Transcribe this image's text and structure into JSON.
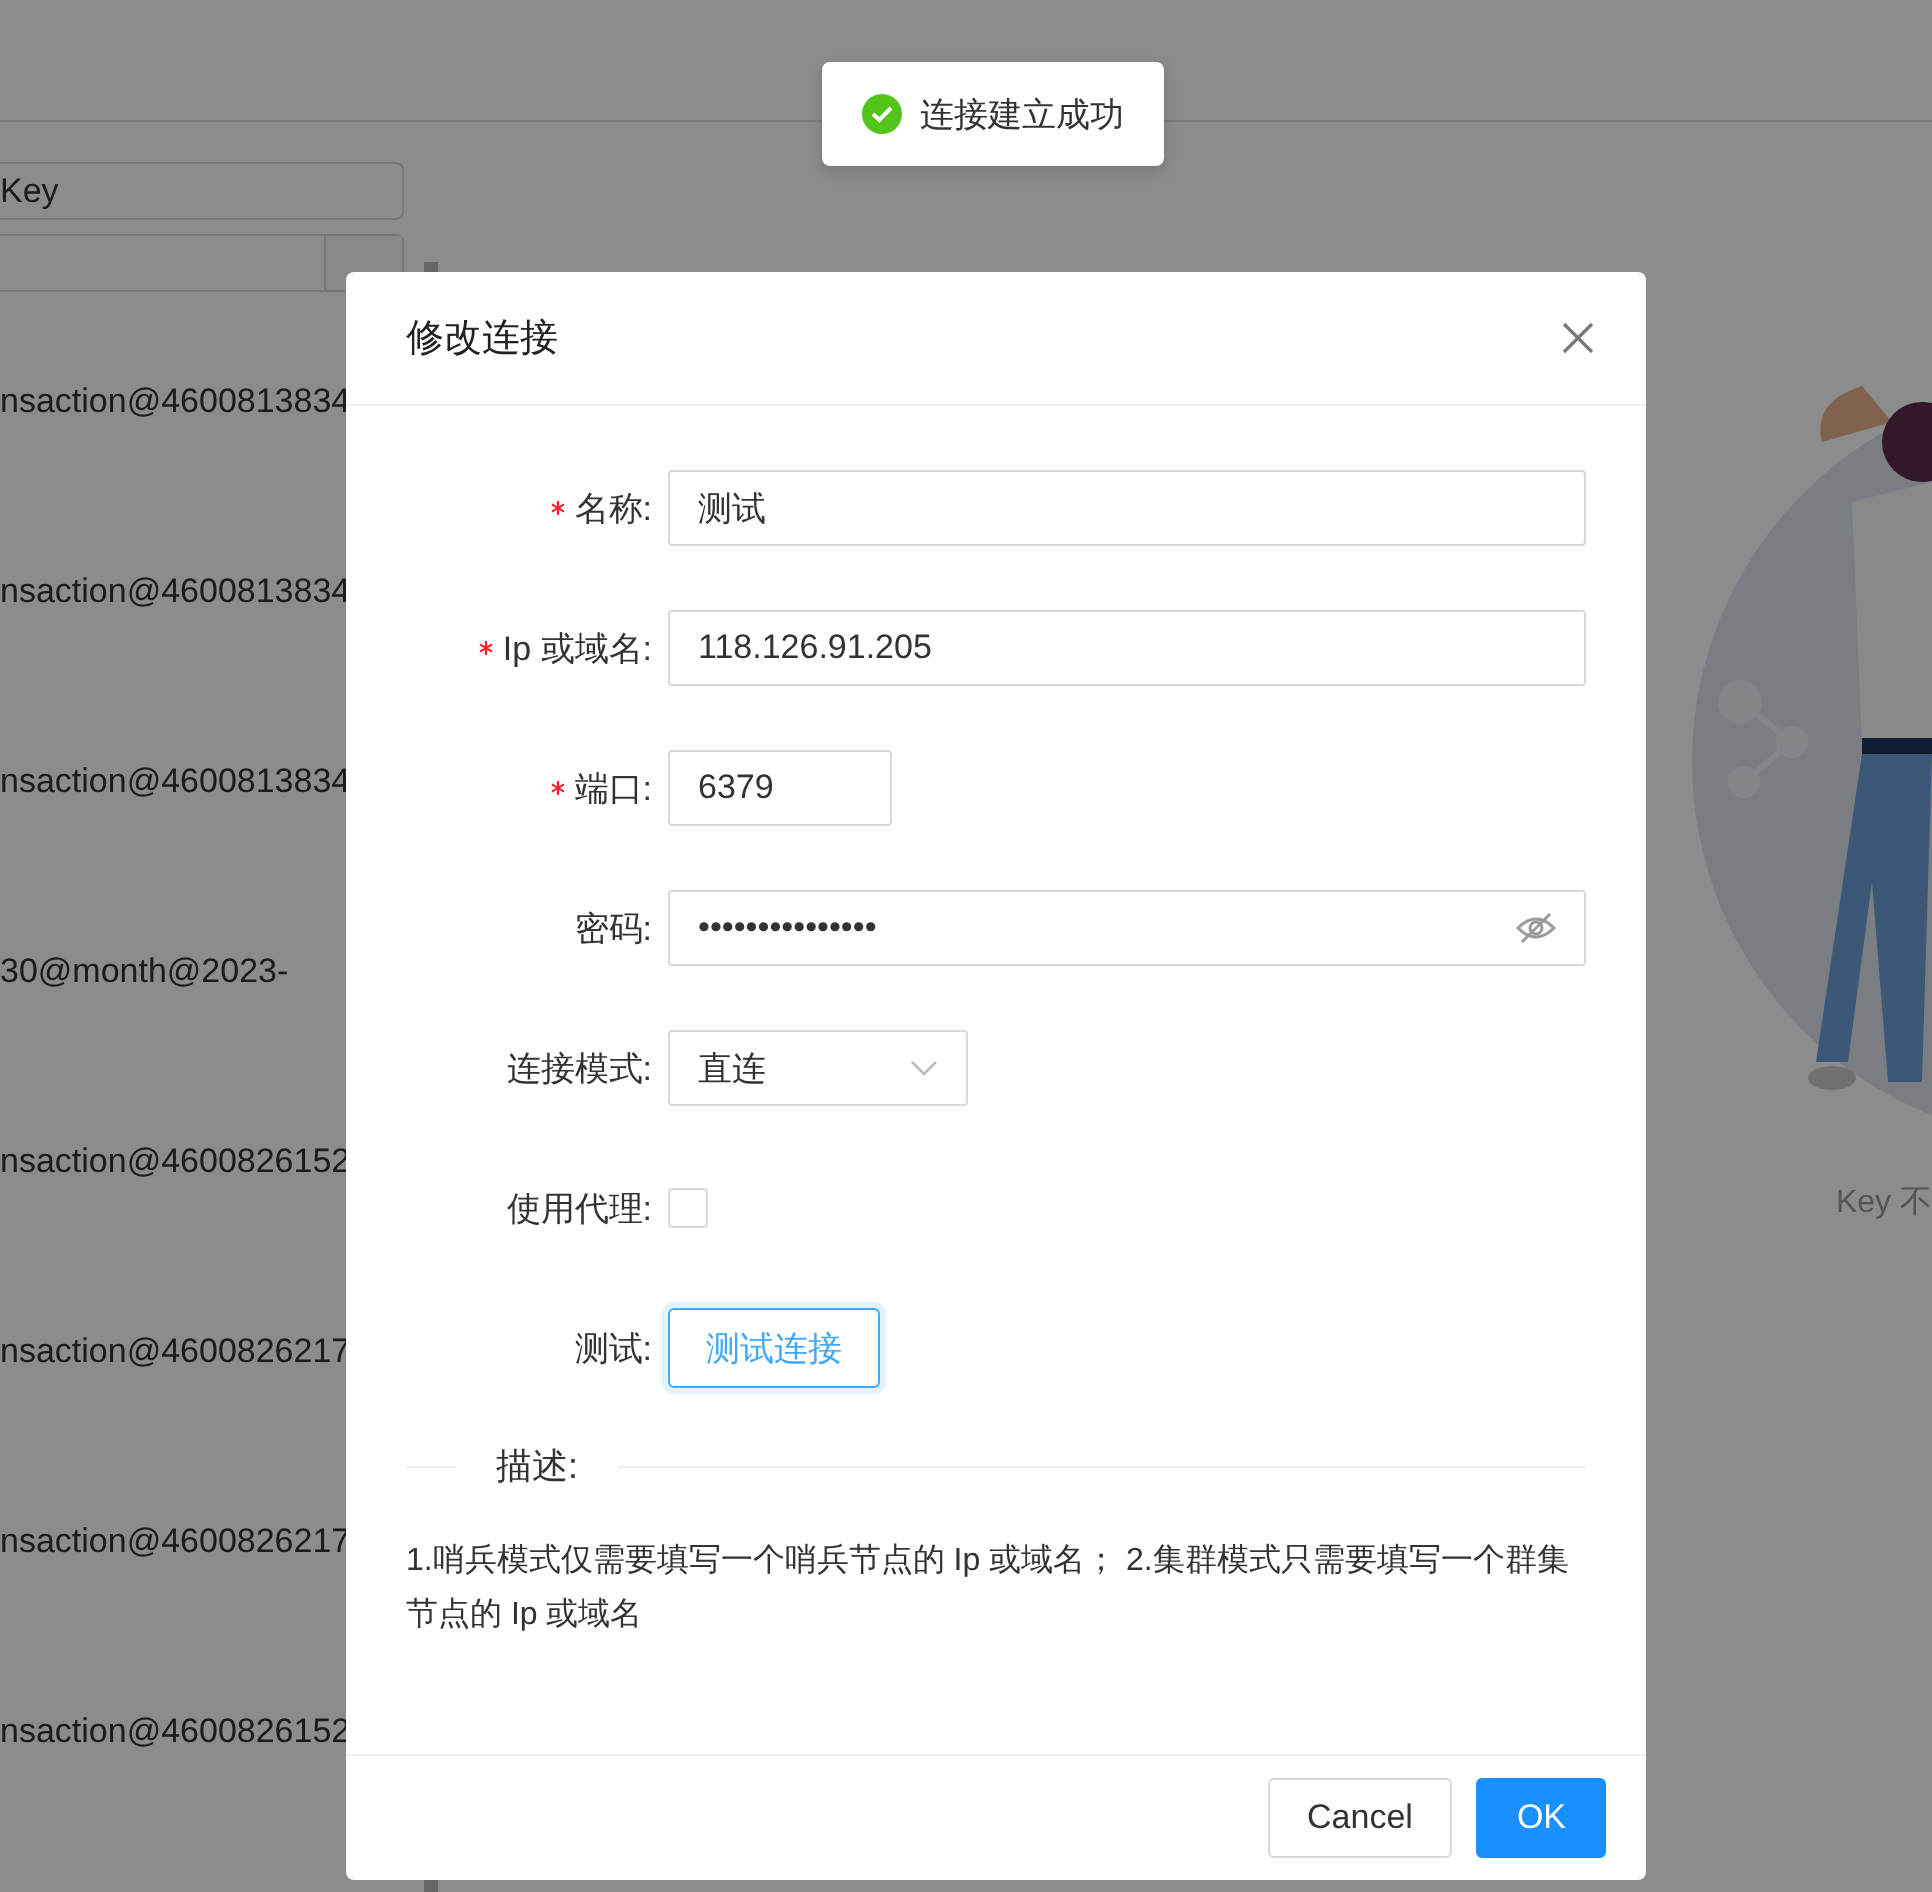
{
  "toast": {
    "text": "连接建立成功"
  },
  "sidebar": {
    "search": {
      "placeholder": "Key"
    },
    "items": [
      {
        "text": "nsaction@4600813834"
      },
      {
        "text": "nsaction@4600813834"
      },
      {
        "text": "nsaction@4600813834"
      },
      {
        "text": "30@month@2023-"
      },
      {
        "text": "nsaction@4600826152"
      },
      {
        "text": "nsaction@4600826217"
      },
      {
        "text": "nsaction@4600826217"
      },
      {
        "text": "nsaction@4600826152"
      }
    ]
  },
  "empty_state": {
    "text": "Key 不"
  },
  "dialog": {
    "title": "修改连接",
    "fields": [
      {
        "kind": "text",
        "label": "名称:",
        "required": true,
        "value": "测试"
      },
      {
        "kind": "text",
        "label": "Ip 或域名:",
        "required": true,
        "value": "118.126.91.205"
      },
      {
        "kind": "short",
        "label": "端口:",
        "required": true,
        "value": "6379"
      },
      {
        "kind": "password",
        "label": "密码:",
        "required": false,
        "value": "•••••••••••••••"
      },
      {
        "kind": "select",
        "label": "连接模式:",
        "required": false,
        "value": "直连"
      },
      {
        "kind": "checkbox",
        "label": "使用代理:",
        "required": false,
        "checked": false
      },
      {
        "kind": "button",
        "label": "测试:",
        "required": false,
        "button": "测试连接"
      }
    ],
    "section": "描述:",
    "description": "1.哨兵模式仅需要填写一个哨兵节点的 Ip 或域名； 2.集群模式只需要填写一个群集节点的 Ip 或域名",
    "buttons": [
      {
        "label": "Cancel",
        "kind": "default"
      },
      {
        "label": "OK",
        "kind": "primary"
      }
    ]
  }
}
